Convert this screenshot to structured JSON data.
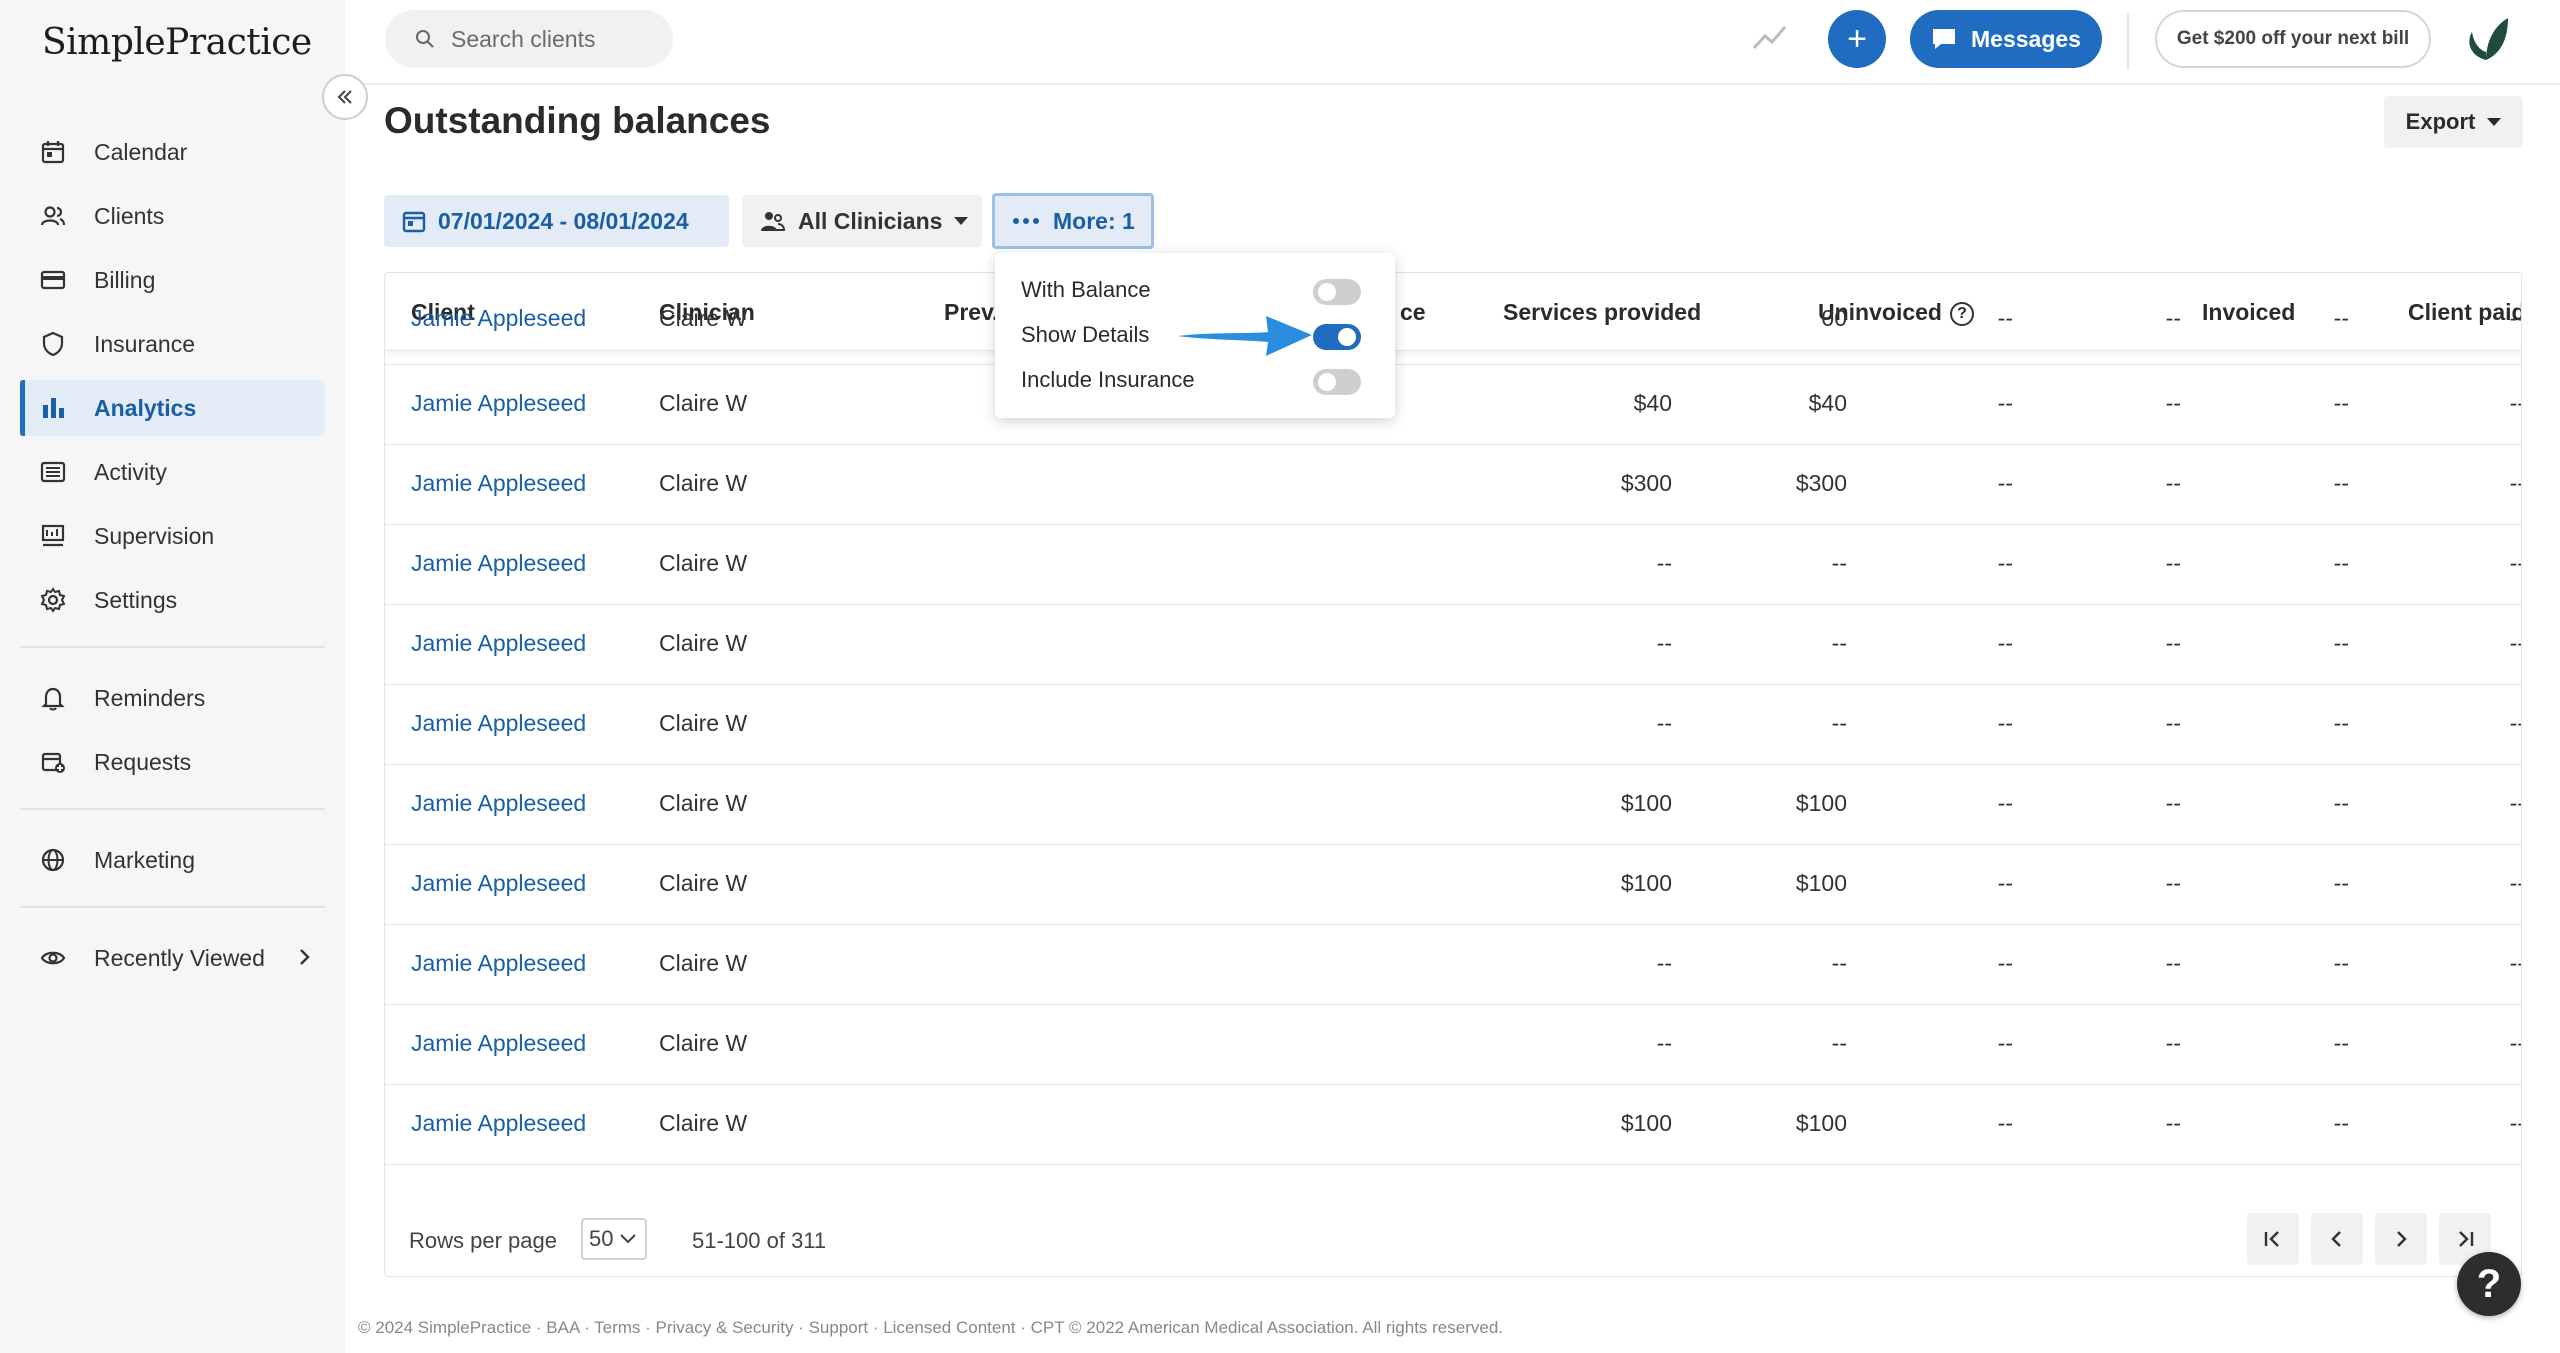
{
  "brand": {
    "logo_text": "SimplePractice",
    "accent": "#1f6cc0"
  },
  "sidebar": {
    "items": [
      {
        "label": "Calendar",
        "icon": "calendar-icon"
      },
      {
        "label": "Clients",
        "icon": "users-icon"
      },
      {
        "label": "Billing",
        "icon": "credit-card-icon"
      },
      {
        "label": "Insurance",
        "icon": "shield-icon"
      },
      {
        "label": "Analytics",
        "icon": "bar-chart-icon",
        "active": true
      },
      {
        "label": "Activity",
        "icon": "list-icon"
      },
      {
        "label": "Supervision",
        "icon": "supervision-icon"
      },
      {
        "label": "Settings",
        "icon": "gear-icon"
      }
    ],
    "secondary": [
      {
        "label": "Reminders",
        "icon": "bell-icon"
      },
      {
        "label": "Requests",
        "icon": "calendar-plus-icon"
      }
    ],
    "tertiary": [
      {
        "label": "Marketing",
        "icon": "globe-icon"
      }
    ],
    "recently_viewed": {
      "label": "Recently Viewed",
      "icon": "eye-icon"
    }
  },
  "topbar": {
    "search_placeholder": "Search clients",
    "messages_label": "Messages",
    "promo_label": "Get $200 off your next bill"
  },
  "page": {
    "title": "Outstanding balances",
    "export_label": "Export"
  },
  "filters": {
    "date_range": "07/01/2024 - 08/01/2024",
    "clinicians": "All Clinicians",
    "more": "More: 1"
  },
  "more_menu": {
    "options": [
      {
        "label": "With Balance",
        "enabled": false
      },
      {
        "label": "Show Details",
        "enabled": true
      },
      {
        "label": "Include Insurance",
        "enabled": false
      }
    ]
  },
  "table": {
    "headers": {
      "client": "Client",
      "clinician": "Clinician",
      "prev": "Prev.",
      "balance_partial": "ce",
      "services": "Services provided",
      "uninvoiced": "Uninvoiced",
      "invoiced": "Invoiced",
      "client_paid": "Client paid"
    },
    "rows": [
      {
        "client": "Jamie Appleseed",
        "clinician": "Claire W",
        "prev": "",
        "balance": "00",
        "services": "--",
        "uninvoiced": "--",
        "invoiced": "--",
        "client_paid": "--"
      },
      {
        "client": "Jamie Appleseed",
        "clinician": "Claire W",
        "prev": "$40",
        "balance": "$40",
        "services": "--",
        "uninvoiced": "--",
        "invoiced": "--",
        "client_paid": "--"
      },
      {
        "client": "Jamie Appleseed",
        "clinician": "Claire W",
        "prev": "$300",
        "balance": "$300",
        "services": "--",
        "uninvoiced": "--",
        "invoiced": "--",
        "client_paid": "--"
      },
      {
        "client": "Jamie Appleseed",
        "clinician": "Claire W",
        "prev": "--",
        "balance": "--",
        "services": "--",
        "uninvoiced": "--",
        "invoiced": "--",
        "client_paid": "--"
      },
      {
        "client": "Jamie Appleseed",
        "clinician": "Claire W",
        "prev": "--",
        "balance": "--",
        "services": "--",
        "uninvoiced": "--",
        "invoiced": "--",
        "client_paid": "--"
      },
      {
        "client": "Jamie Appleseed",
        "clinician": "Claire W",
        "prev": "--",
        "balance": "--",
        "services": "--",
        "uninvoiced": "--",
        "invoiced": "--",
        "client_paid": "--"
      },
      {
        "client": "Jamie Appleseed",
        "clinician": "Claire W",
        "prev": "$100",
        "balance": "$100",
        "services": "--",
        "uninvoiced": "--",
        "invoiced": "--",
        "client_paid": "--"
      },
      {
        "client": "Jamie Appleseed",
        "clinician": "Claire W",
        "prev": "$100",
        "balance": "$100",
        "services": "--",
        "uninvoiced": "--",
        "invoiced": "--",
        "client_paid": "--"
      },
      {
        "client": "Jamie Appleseed",
        "clinician": "Claire W",
        "prev": "--",
        "balance": "--",
        "services": "--",
        "uninvoiced": "--",
        "invoiced": "--",
        "client_paid": "--"
      },
      {
        "client": "Jamie Appleseed",
        "clinician": "Claire W",
        "prev": "--",
        "balance": "--",
        "services": "--",
        "uninvoiced": "--",
        "invoiced": "--",
        "client_paid": "--"
      },
      {
        "client": "Jamie Appleseed",
        "clinician": "Claire W",
        "prev": "$100",
        "balance": "$100",
        "services": "--",
        "uninvoiced": "--",
        "invoiced": "--",
        "client_paid": "--"
      }
    ]
  },
  "pagination": {
    "rows_per_page_label": "Rows per page",
    "rows_per_page_value": "50",
    "range": "51-100 of 311"
  },
  "footer": {
    "copyright": "© 2024 SimplePractice · BAA · Terms · Privacy & Security · Support · Licensed Content · CPT © 2022 American Medical Association. All rights reserved."
  },
  "help": {
    "label": "?"
  }
}
